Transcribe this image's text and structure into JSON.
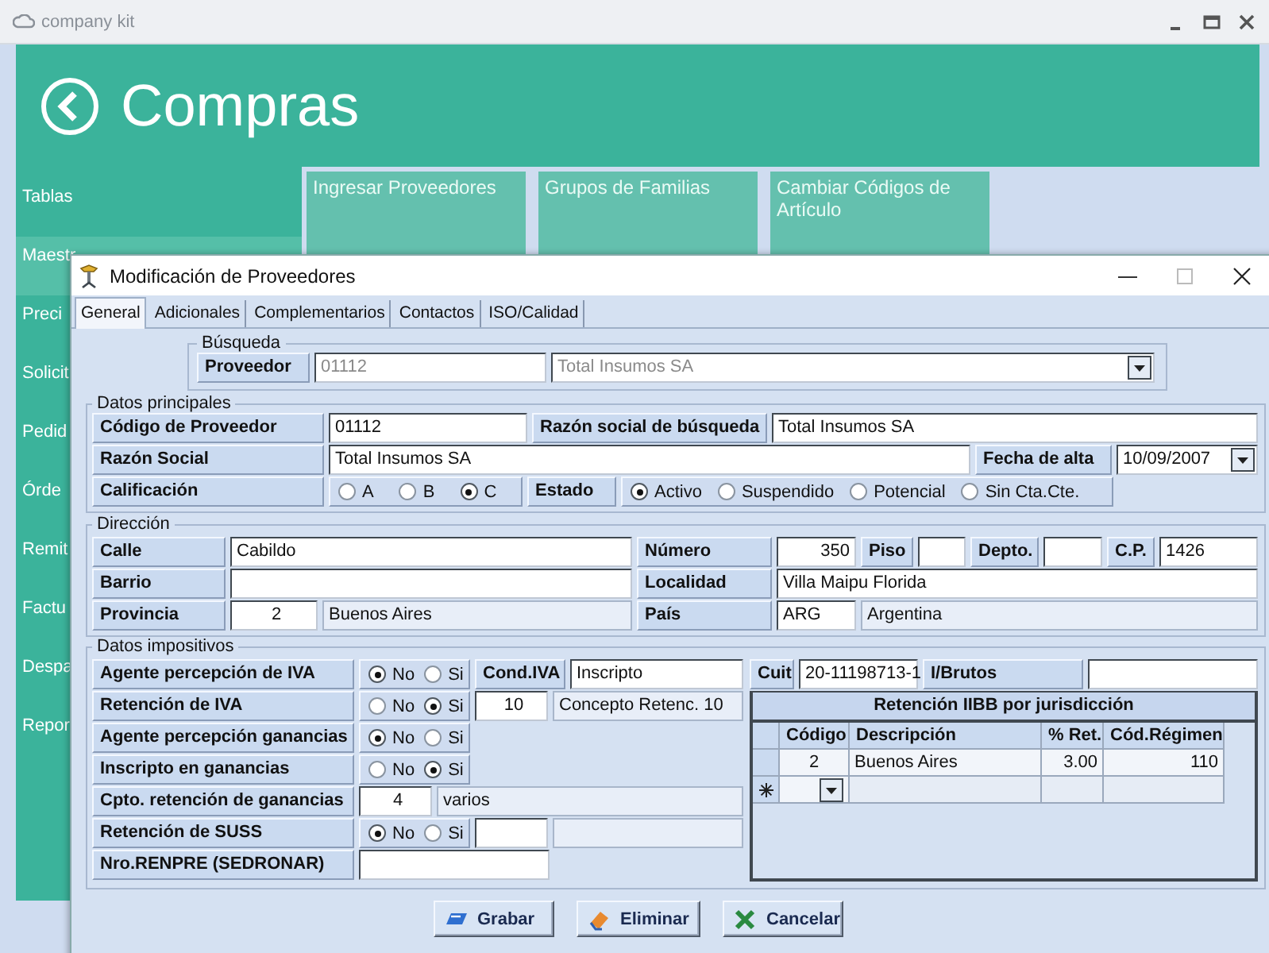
{
  "app": {
    "title": "company kit",
    "header": "Compras",
    "menu": [
      {
        "label": "Tablas",
        "selected": false
      },
      {
        "label": "Maestr",
        "selected": true
      },
      {
        "label": "Preci",
        "selected": false
      },
      {
        "label": "Solicit",
        "selected": false
      },
      {
        "label": "Pedid",
        "selected": false
      },
      {
        "label": "Órde",
        "selected": false
      },
      {
        "label": "Remit",
        "selected": false
      },
      {
        "label": "Factu",
        "selected": false
      },
      {
        "label": "Despa",
        "selected": false
      },
      {
        "label": "Repor",
        "selected": false
      }
    ],
    "tiles": [
      {
        "label": "Ingresar Proveedores"
      },
      {
        "label": "Grupos de Familias"
      },
      {
        "label": "Cambiar Códigos de Artículo"
      }
    ]
  },
  "dialog": {
    "title": "Modificación de Proveedores",
    "tabs": [
      {
        "label": "General",
        "selected": true
      },
      {
        "label": "Adicionales",
        "selected": false
      },
      {
        "label": "Complementarios",
        "selected": false
      },
      {
        "label": "Contactos",
        "selected": false
      },
      {
        "label": "ISO/Calidad",
        "selected": false
      }
    ],
    "sections": [
      {
        "legend": "Búsqueda",
        "lines": [
          {
            "fields": [
              {
                "kind": "label",
                "text": "Proveedor"
              },
              {
                "kind": "field",
                "value": "01112",
                "disabled": true
              },
              {
                "kind": "combo",
                "value": "Total Insumos SA",
                "disabled": true
              }
            ]
          }
        ]
      },
      {
        "legend": "Datos principales",
        "lines": [
          {
            "fields": [
              {
                "kind": "label",
                "text": "Código de Proveedor"
              },
              {
                "kind": "field",
                "value": "01112"
              },
              {
                "kind": "label",
                "text": "Razón social de búsqueda"
              },
              {
                "kind": "field",
                "value": "Total Insumos SA"
              }
            ]
          },
          {
            "fields": [
              {
                "kind": "label",
                "text": "Razón Social"
              },
              {
                "kind": "field",
                "value": "Total Insumos SA"
              },
              {
                "kind": "label",
                "text": "Fecha de alta"
              },
              {
                "kind": "date",
                "value": "10/09/2007"
              }
            ]
          },
          {
            "fields": [
              {
                "kind": "label",
                "text": "Calificación"
              },
              {
                "kind": "radios",
                "options": [
                  {
                    "label": "A",
                    "selected": false
                  },
                  {
                    "label": "B",
                    "selected": false
                  },
                  {
                    "label": "C",
                    "selected": true
                  }
                ]
              },
              {
                "kind": "label",
                "text": "Estado"
              },
              {
                "kind": "radios",
                "options": [
                  {
                    "label": "Activo",
                    "selected": true
                  },
                  {
                    "label": "Suspendido",
                    "selected": false
                  },
                  {
                    "label": "Potencial",
                    "selected": false
                  },
                  {
                    "label": "Sin Cta.Cte.",
                    "selected": false
                  }
                ]
              }
            ]
          }
        ]
      },
      {
        "legend": "Dirección",
        "lines": [
          {
            "fields": [
              {
                "kind": "label",
                "text": "Calle"
              },
              {
                "kind": "field",
                "value": "Cabildo"
              },
              {
                "kind": "label",
                "text": "Número"
              },
              {
                "kind": "field",
                "value": "350"
              },
              {
                "kind": "label",
                "text": "Piso"
              },
              {
                "kind": "field"
              },
              {
                "kind": "label",
                "text": "Depto."
              },
              {
                "kind": "field"
              },
              {
                "kind": "label",
                "text": "C.P."
              },
              {
                "kind": "field",
                "value": "1426"
              }
            ]
          },
          {
            "fields": [
              {
                "kind": "label",
                "text": "Barrio"
              },
              {
                "kind": "field"
              },
              {
                "kind": "label",
                "text": "Localidad"
              },
              {
                "kind": "field",
                "value": "Villa Maipu Florida"
              }
            ]
          },
          {
            "fields": [
              {
                "kind": "label",
                "text": "Provincia"
              },
              {
                "kind": "field",
                "value": "2"
              },
              {
                "kind": "readonly",
                "value": "Buenos Aires"
              },
              {
                "kind": "label",
                "text": "País"
              },
              {
                "kind": "field",
                "value": "ARG"
              },
              {
                "kind": "readonly",
                "value": "Argentina"
              }
            ]
          }
        ]
      }
    ],
    "tax": {
      "legend": "Datos impositivos",
      "lines": [
        {
          "fields": [
            {
              "kind": "label",
              "text": "Agente percepción de IVA"
            },
            {
              "kind": "radios",
              "options": [
                {
                  "label": "No",
                  "selected": true
                },
                {
                  "label": "Si",
                  "selected": false
                }
              ]
            },
            {
              "kind": "label",
              "text": "Cond.IVA"
            },
            {
              "kind": "field",
              "value": "Inscripto"
            }
          ]
        },
        {
          "fields": [
            {
              "kind": "label",
              "text": "Retención de IVA"
            },
            {
              "kind": "radios",
              "options": [
                {
                  "label": "No",
                  "selected": false
                },
                {
                  "label": "Si",
                  "selected": true
                }
              ]
            },
            {
              "kind": "field",
              "value": "10"
            },
            {
              "kind": "readonly",
              "value": "Concepto Retenc. 10"
            }
          ]
        },
        {
          "fields": [
            {
              "kind": "label",
              "text": "Agente percepción ganancias"
            },
            {
              "kind": "radios",
              "options": [
                {
                  "label": "No",
                  "selected": true
                },
                {
                  "label": "Si",
                  "selected": false
                }
              ]
            }
          ]
        },
        {
          "fields": [
            {
              "kind": "label",
              "text": "Inscripto en ganancias"
            },
            {
              "kind": "radios",
              "options": [
                {
                  "label": "No",
                  "selected": false
                },
                {
                  "label": "Si",
                  "selected": true
                }
              ]
            }
          ]
        },
        {
          "fields": [
            {
              "kind": "label",
              "text": "Cpto. retención de ganancias"
            },
            {
              "kind": "field",
              "value": "4"
            },
            {
              "kind": "readonly",
              "value": "varios"
            }
          ]
        },
        {
          "fields": [
            {
              "kind": "label",
              "text": "Retención de SUSS"
            },
            {
              "kind": "radios",
              "options": [
                {
                  "label": "No",
                  "selected": true
                },
                {
                  "label": "Si",
                  "selected": false
                }
              ]
            },
            {
              "kind": "field"
            },
            {
              "kind": "readonly"
            }
          ]
        },
        {
          "fields": [
            {
              "kind": "label",
              "text": "Nro.RENPRE (SEDRONAR)"
            },
            {
              "kind": "field"
            }
          ]
        }
      ],
      "side_row": {
        "fields": [
          {
            "kind": "label",
            "text": "Cuit"
          },
          {
            "kind": "field",
            "value": "20-11198713-1"
          },
          {
            "kind": "label",
            "text": "I/Brutos"
          },
          {
            "kind": "field"
          }
        ]
      },
      "grid": {
        "title": "Retención IIBB por jurisdicción",
        "columns": [
          "Código",
          "Descripción",
          "% Ret.",
          "Cód.Régimen"
        ],
        "rows": [
          [
            "2",
            "Buenos Aires",
            "3.00",
            "110"
          ]
        ]
      }
    },
    "buttons": [
      {
        "label": "Grabar"
      },
      {
        "label": "Eliminar"
      },
      {
        "label": "Cancelar"
      }
    ]
  }
}
